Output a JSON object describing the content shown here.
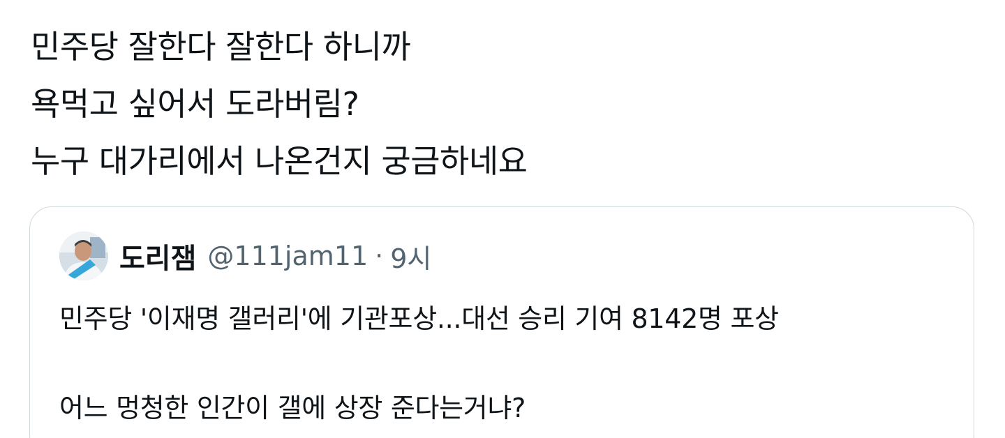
{
  "tweet": {
    "lines": [
      "민주당 잘한다 잘한다 하니까",
      "욕먹고 싶어서 도라버림?",
      "누구 대가리에서 나온건지 궁금하네요"
    ]
  },
  "quote": {
    "display_name": "도리잼",
    "handle": "@111jam11",
    "separator": "·",
    "time": "9시",
    "avatar_icon": "profile-photo",
    "lines": [
      "민주당 '이재명 갤러리'에 기관포상...대선 승리 기여 8142명 포상",
      "어느 멍청한 인간이 갤에 상장 준다는거냐?"
    ]
  },
  "colors": {
    "text": "#0f1419",
    "secondary": "#536471",
    "border": "#cfd9de"
  }
}
